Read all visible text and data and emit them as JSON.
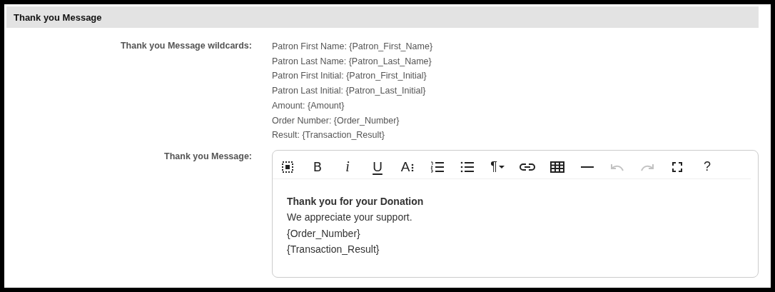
{
  "section": {
    "title": "Thank you Message"
  },
  "fields": [
    {
      "kind": "list",
      "label": "Thank you Message wildcards:",
      "items": [
        "Patron First Name: {Patron_First_Name}",
        "Patron Last Name: {Patron_Last_Name}",
        "Patron First Initial: {Patron_First_Initial}",
        "Patron Last Initial: {Patron_Last_Initial}",
        "Amount: {Amount}",
        "Order Number: {Order_Number}",
        "Result: {Transaction_Result}"
      ]
    },
    {
      "kind": "editor",
      "label": "Thank you Message:",
      "toolbar": [
        {
          "kind": "select-all",
          "disabled": false
        },
        {
          "kind": "bold",
          "label": "B",
          "disabled": false
        },
        {
          "kind": "italic",
          "label": "i",
          "disabled": false
        },
        {
          "kind": "underline",
          "label": "U",
          "disabled": false
        },
        {
          "kind": "font-size",
          "label": "A",
          "disabled": false
        },
        {
          "kind": "ordered-list",
          "disabled": false
        },
        {
          "kind": "bullet-list",
          "disabled": false
        },
        {
          "kind": "paragraph",
          "label": "¶",
          "disabled": false
        },
        {
          "kind": "link",
          "disabled": false
        },
        {
          "kind": "table",
          "disabled": false
        },
        {
          "kind": "rule",
          "disabled": false
        },
        {
          "kind": "undo",
          "disabled": true
        },
        {
          "kind": "redo",
          "disabled": true
        },
        {
          "kind": "fullscreen",
          "disabled": false
        },
        {
          "kind": "help",
          "label": "?",
          "disabled": false
        }
      ],
      "content": [
        {
          "text": "Thank you for your Donation",
          "bold": true
        },
        {
          "text": "We appreciate your support.",
          "bold": false
        },
        {
          "text": "{Order_Number}",
          "bold": false
        },
        {
          "text": "{Transaction_Result}",
          "bold": false
        }
      ]
    }
  ]
}
